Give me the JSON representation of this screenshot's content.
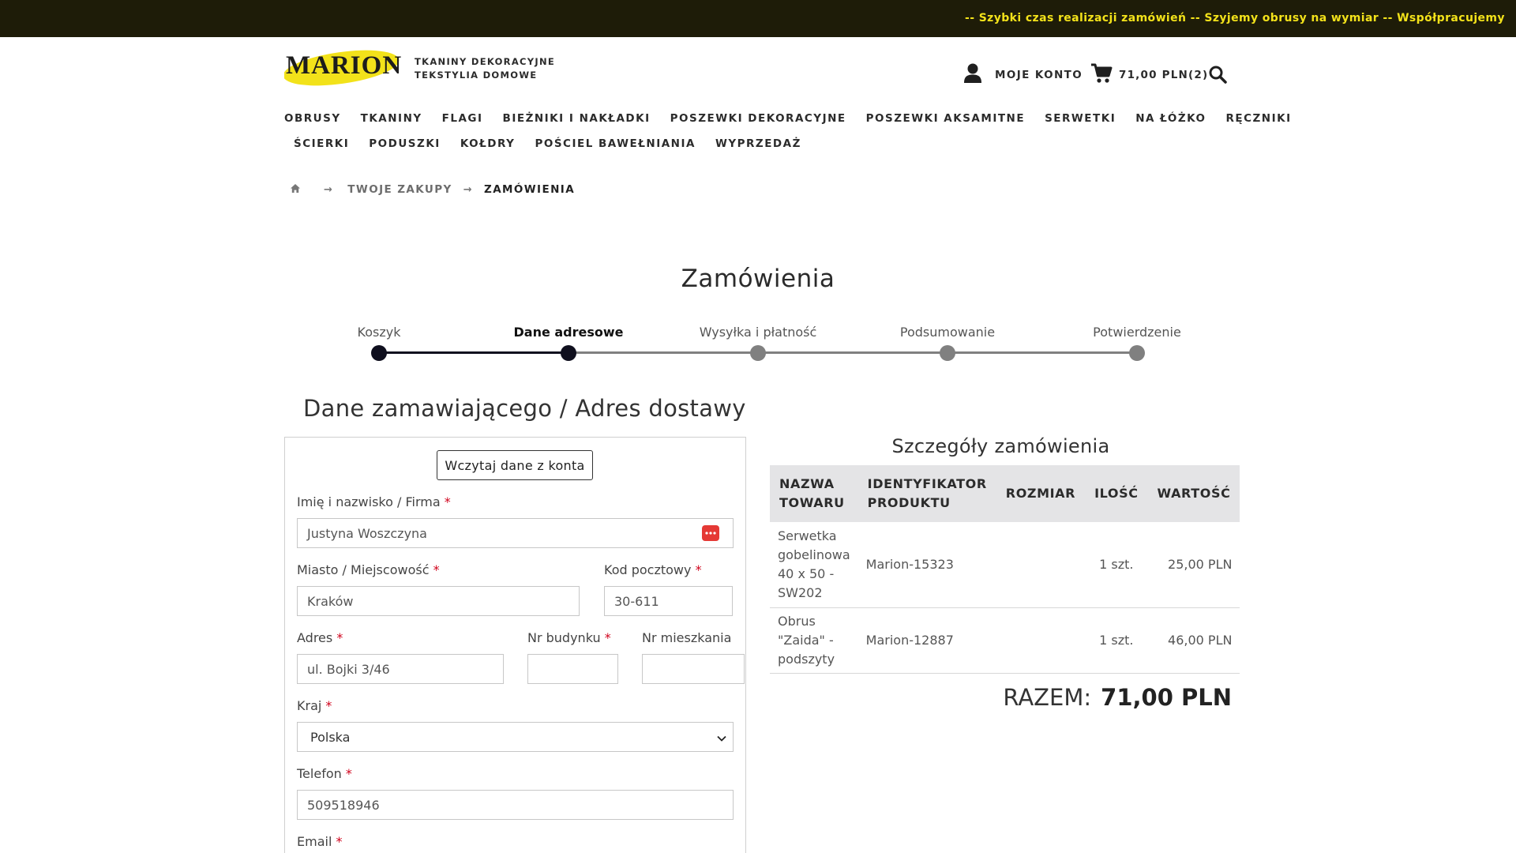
{
  "topbar": {
    "ticker": "--  Szybki czas realizacji zamówień  --  Szyjemy obrusy na wymiar  --  Współpracujemy"
  },
  "header": {
    "logo_text": "MARION",
    "tagline_line1": "TKANINY DEKORACYJNE",
    "tagline_line2": "TEKSTYLIA DOMOWE",
    "account_label": "MOJE KONTO",
    "cart_label": "71,00 PLN(2)"
  },
  "nav": {
    "row1": [
      "OBRUSY",
      "TKANINY",
      "FLAGI",
      "BIEŻNIKI I NAKŁADKI",
      "POSZEWKI DEKORACYJNE",
      "POSZEWKI AKSAMITNE",
      "SERWETKI",
      "NA ŁÓŻKO",
      "RĘCZNIKI"
    ],
    "row2": [
      "ŚCIERKI",
      "PODUSZKI",
      "KOŁDRY",
      "POŚCIEL BAWEŁNIANIA",
      "WYPRZEDAŻ"
    ]
  },
  "breadcrumb": {
    "crumb1": "TWOJE ZAKUPY",
    "current": "ZAMÓWIENIA"
  },
  "page_title": "Zamówienia",
  "steps": [
    {
      "label": "Koszyk",
      "state": "done"
    },
    {
      "label": "Dane adresowe",
      "state": "active"
    },
    {
      "label": "Wysyłka i płatność",
      "state": "pending"
    },
    {
      "label": "Podsumowanie",
      "state": "pending"
    },
    {
      "label": "Potwierdzenie",
      "state": "pending"
    }
  ],
  "form": {
    "section_title": "Dane zamawiającego / Adres dostawy",
    "load_button": "Wczytaj dane z konta",
    "name_label": "Imię i nazwisko / Firma",
    "name_value": "Justyna Woszczyna",
    "city_label": "Miasto / Miejscowość",
    "city_value": "Kraków",
    "postal_label": "Kod pocztowy",
    "postal_value": "30-611",
    "address_label": "Adres",
    "address_value": "ul. Bojki 3/46",
    "building_label": "Nr budynku",
    "building_value": "",
    "apartment_label": "Nr mieszkania",
    "apartment_value": "",
    "country_label": "Kraj",
    "country_value": "Polska",
    "phone_label": "Telefon",
    "phone_value": "509518946",
    "email_label": "Email",
    "required_mark": "*"
  },
  "order": {
    "title": "Szczegóły zamówienia",
    "headers": [
      "NAZWA TOWARU",
      "IDENTYFIKATOR PRODUKTU",
      "ROZMIAR",
      "ILOŚĆ",
      "WARTOŚĆ"
    ],
    "rows": [
      {
        "name": "Serwetka gobelinowa 40 x 50 - SW202",
        "id": "Marion-15323",
        "size": "",
        "qty": "1 szt.",
        "value": "25,00 PLN"
      },
      {
        "name": "Obrus \"Zaida\" - podszyty",
        "id": "Marion-12887",
        "size": "",
        "qty": "1 szt.",
        "value": "46,00 PLN"
      }
    ],
    "total_label": "RAZEM:",
    "total_value": "71,00 PLN"
  },
  "colors": {
    "topbar_bg": "#1e1c08",
    "ticker_text": "#f3e21a",
    "logo_yellow": "#f2e21a",
    "step_done": "#0f0f1e",
    "step_pending": "#808080",
    "required": "#d0021b"
  },
  "icons": {
    "account": "user-icon",
    "cart": "cart-icon",
    "search": "search-icon",
    "home": "home-icon",
    "breadcrumb_sep": "arrow-right-icon",
    "select": "chevron-down-icon",
    "autofill": "password-manager-icon"
  }
}
